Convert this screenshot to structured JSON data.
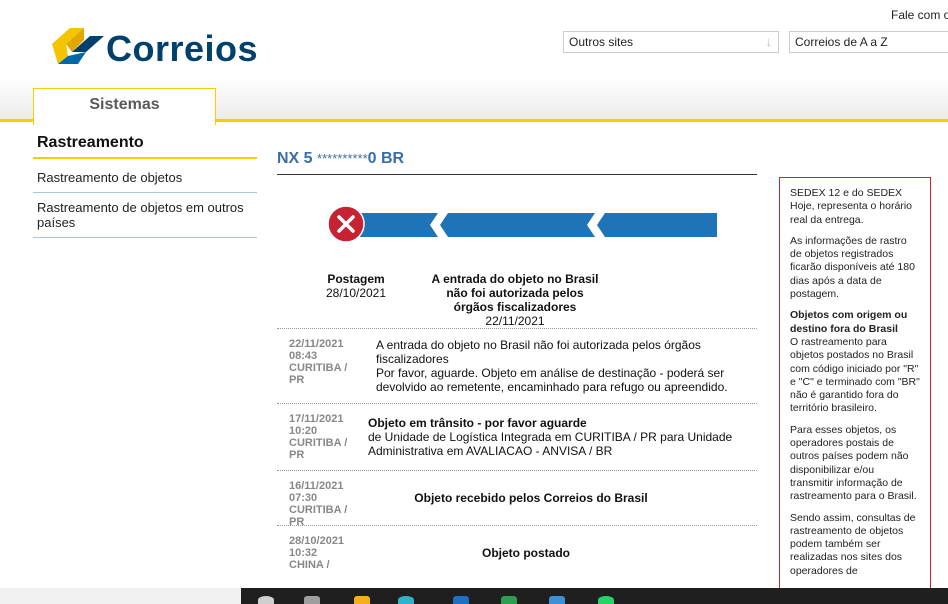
{
  "header": {
    "logo_text": "Correios",
    "fale": "Fale com o",
    "outros_sites": "Outros sites",
    "correios_az": "Correios de A a Z"
  },
  "tabs": {
    "sistemas": "Sistemas"
  },
  "sidebar": {
    "title": "Rastreamento",
    "items": [
      {
        "label": "Rastreamento de objetos"
      },
      {
        "label": "Rastreamento de objetos em outros países"
      }
    ]
  },
  "tracking": {
    "code_prefix": "NX 5",
    "code_mask": "**********",
    "code_suffix": "0 BR",
    "stages": [
      {
        "title": "Postagem",
        "date": "28/10/2021"
      },
      {
        "title": "A entrada do objeto no Brasil não foi autorizada pelos órgãos fiscalizadores",
        "date": "22/11/2021"
      }
    ],
    "events": [
      {
        "date": "22/11/2021",
        "time": "08:43",
        "place": "CURITIBA / PR",
        "title": "",
        "line1": "A entrada do objeto no Brasil não foi autorizada pelos órgãos fiscalizadores",
        "line2": "Por favor, aguarde. Objeto em análise de destinação - poderá ser devolvido ao remetente, encaminhado para refugo ou apreendido."
      },
      {
        "date": "17/11/2021",
        "time": "10:20",
        "place": "CURITIBA / PR",
        "title": "Objeto em trânsito - por favor aguarde",
        "line1": "de Unidade de Logística Integrada em CURITIBA / PR para Unidade Administrativa em AVALIACAO - ANVISA / BR",
        "line2": ""
      },
      {
        "date": "16/11/2021",
        "time": "07:30",
        "place": "CURITIBA / PR",
        "title": "Objeto recebido pelos Correios do Brasil",
        "line1": "",
        "line2": ""
      },
      {
        "date": "28/10/2021",
        "time": "10:32",
        "place": "CHINA /",
        "title": "Objeto postado",
        "line1": "",
        "line2": ""
      }
    ]
  },
  "infobox": {
    "p1": "SEDEX 12 e do SEDEX Hoje, representa o horário real da entrega.",
    "p2": "As informações de rastro de objetos registrados ficarão disponíveis até 180 dias após a data de postagem.",
    "h3": "Objetos com origem ou destino fora do Brasil",
    "p3": "O rastreamento para objetos postados no Brasil com código iniciado por \"R\" e \"C\" e terminado com \"BR\" não é garantido fora do território brasileiro.",
    "p4": "Para esses objetos, os operadores postais de outros países podem não disponibilizar e/ou transmitir informação de rastreamento para o Brasil.",
    "p5": "Sendo assim, consultas de rastreamento de objetos podem também ser realizadas nos sites dos operadores de"
  },
  "colors": {
    "brand_blue": "#00416b",
    "brand_yellow": "#f5d000",
    "progress_blue": "#1f74b8",
    "error_red": "#c62234"
  }
}
